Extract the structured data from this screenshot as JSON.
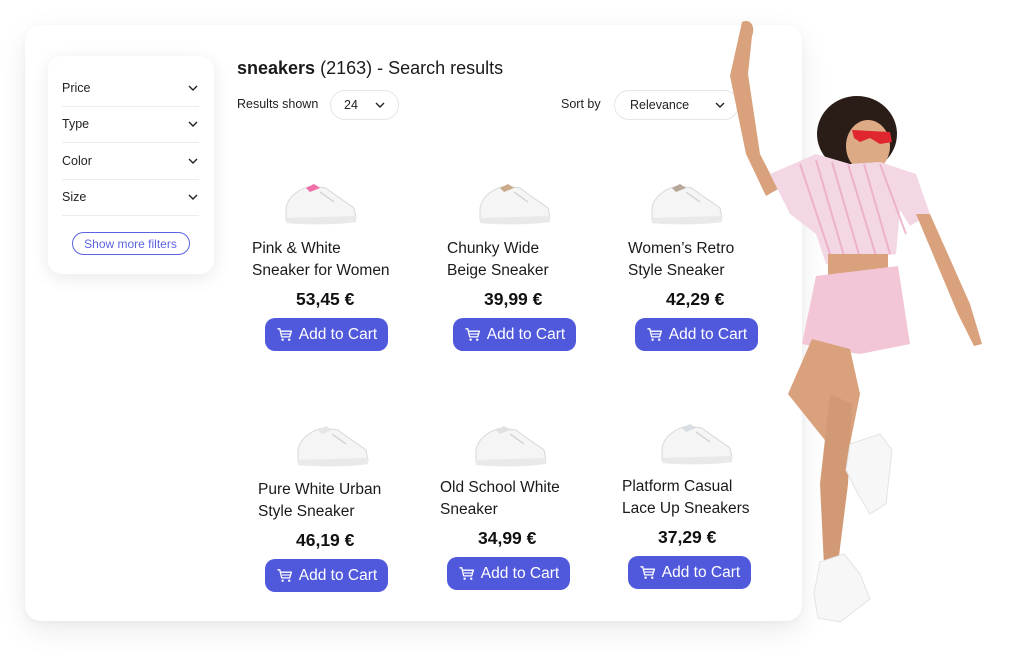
{
  "search": {
    "query": "sneakers",
    "count": "(2163)",
    "suffix": "- Search results"
  },
  "filters": {
    "items": [
      {
        "label": "Price",
        "icon": "chevron-down-icon"
      },
      {
        "label": "Type",
        "icon": "chevron-down-icon"
      },
      {
        "label": "Color",
        "icon": "chevron-down-icon"
      },
      {
        "label": "Size",
        "icon": "chevron-down-icon"
      }
    ],
    "more_label": "Show more filters"
  },
  "toolbar": {
    "results_label": "Results shown",
    "results_value": "24",
    "sort_label": "Sort by",
    "sort_value": "Relevance"
  },
  "colors": {
    "accent": "#5058dc",
    "outline_accent": "#5b63e0"
  },
  "products": [
    {
      "name_line1": "Pink & White",
      "name_line2": "Sneaker for Women",
      "price": "53,45 €",
      "button": "Add to Cart",
      "accent": "#f06fa8"
    },
    {
      "name_line1": "Chunky Wide",
      "name_line2": "Beige Sneaker",
      "price": "39,99 €",
      "button": "Add to Cart",
      "accent": "#c9ab8a"
    },
    {
      "name_line1": "Women’s Retro",
      "name_line2": "Style Sneaker",
      "price": "42,29 €",
      "button": "Add to Cart",
      "accent": "#b8a89a"
    },
    {
      "name_line1": "Pure White Urban",
      "name_line2": "Style Sneaker",
      "price": "46,19 €",
      "button": "Add to Cart",
      "accent": "#e6e6e6"
    },
    {
      "name_line1": "Old School White",
      "name_line2": "Sneaker",
      "price": "34,99 €",
      "button": "Add to Cart",
      "accent": "#e0e0e0"
    },
    {
      "name_line1": "Platform Casual",
      "name_line2": "Lace Up Sneakers",
      "price": "37,29 €",
      "button": "Add to Cart",
      "accent": "#d8dde3"
    }
  ]
}
